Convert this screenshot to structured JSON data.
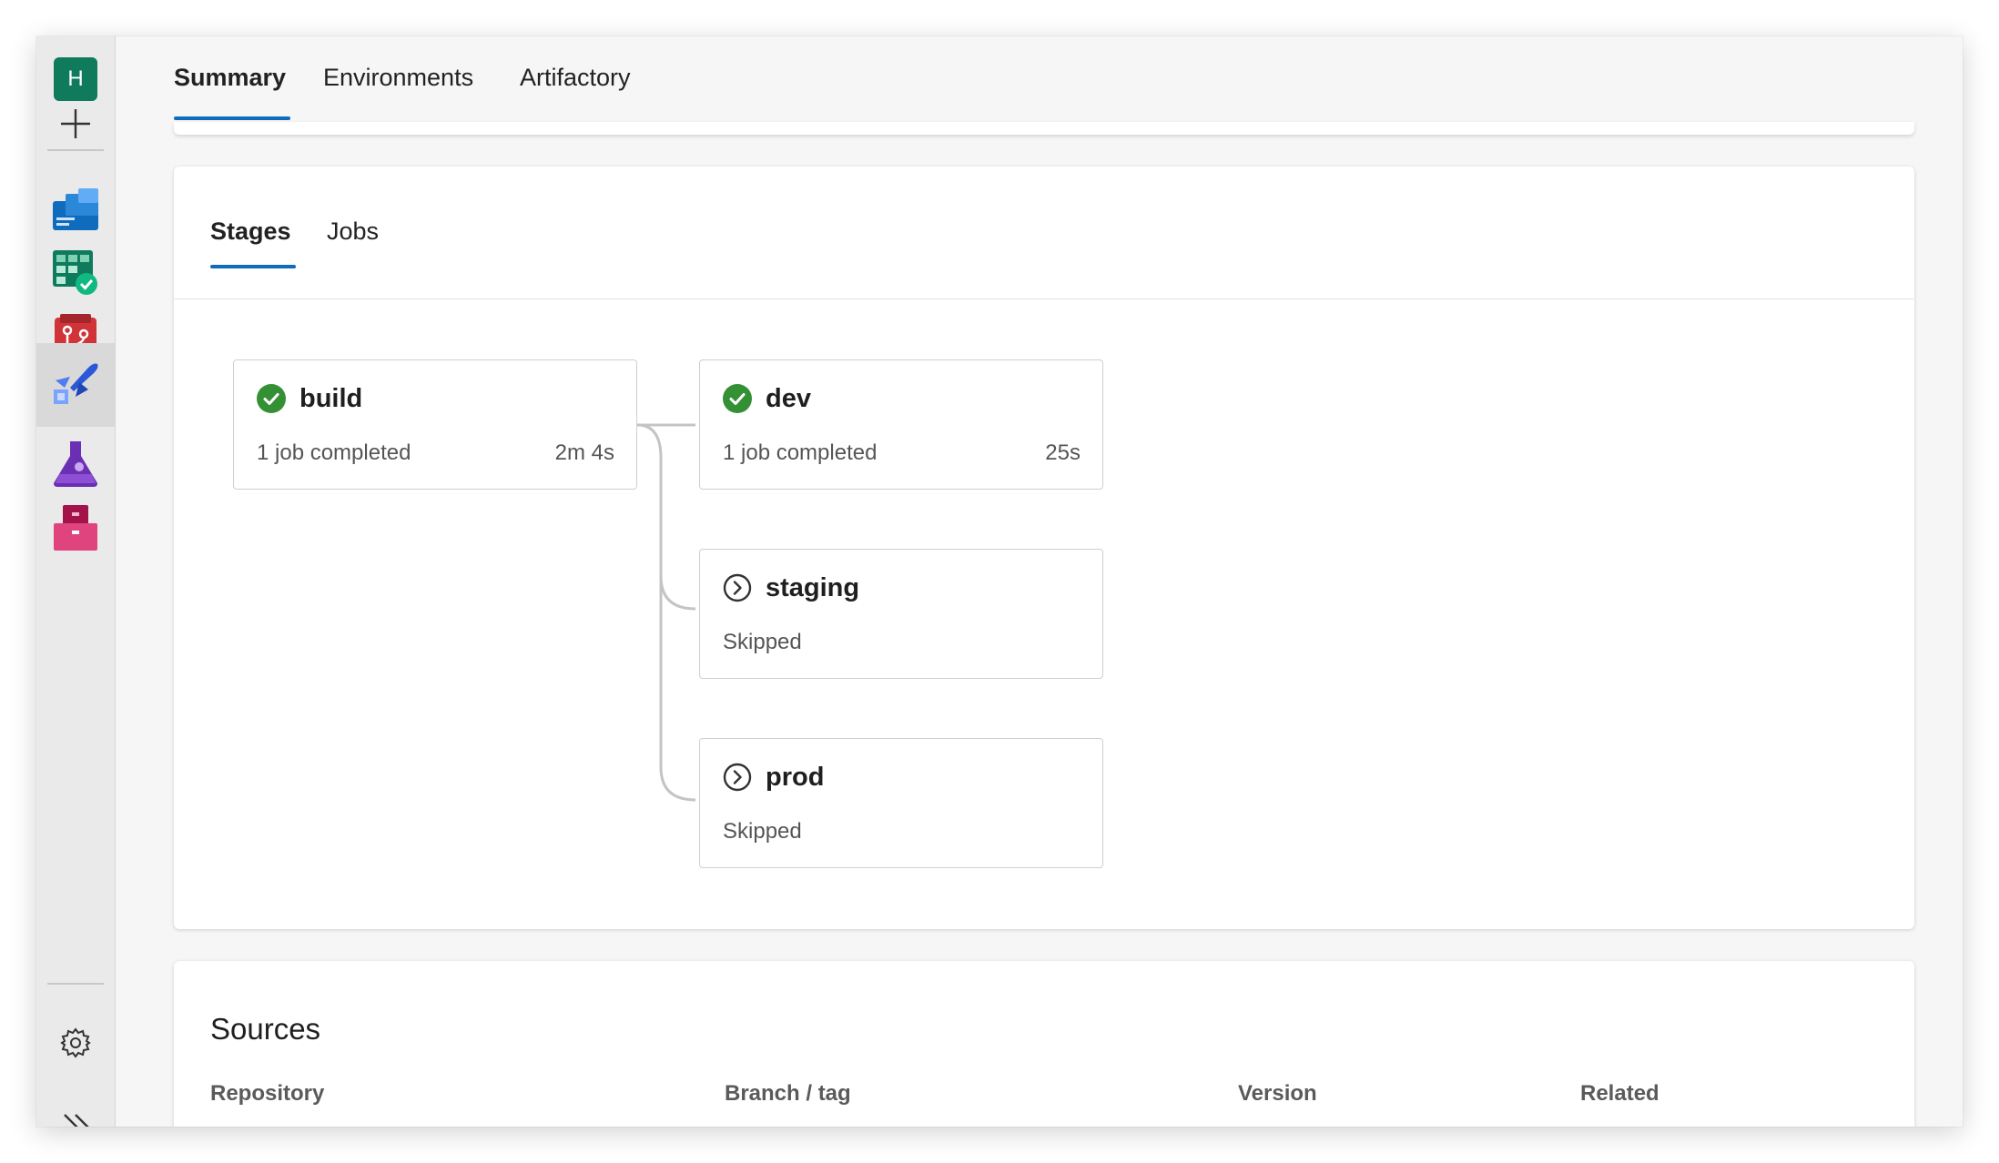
{
  "sidebar": {
    "avatar_letter": "H",
    "items": [
      {
        "name": "new",
        "icon": "plus-icon"
      },
      {
        "name": "overview",
        "icon": "overview-icon",
        "color": "#0f6cbd"
      },
      {
        "name": "boards",
        "icon": "boards-icon",
        "color": "#0f7b5c"
      },
      {
        "name": "repos",
        "icon": "repos-icon",
        "color": "#d13438"
      },
      {
        "name": "pipelines",
        "icon": "pipelines-icon",
        "color": "#2b58d6",
        "active": true
      },
      {
        "name": "test-plans",
        "icon": "test-plans-icon",
        "color": "#6b2fb3"
      },
      {
        "name": "artifacts",
        "icon": "artifacts-icon",
        "color": "#c4205a"
      },
      {
        "name": "settings",
        "icon": "gear-icon"
      },
      {
        "name": "expand",
        "icon": "double-chevron-right-icon"
      }
    ]
  },
  "top_tabs": [
    {
      "label": "Summary",
      "active": true
    },
    {
      "label": "Environments",
      "active": false
    },
    {
      "label": "Artifactory",
      "active": false
    }
  ],
  "sub_tabs": [
    {
      "label": "Stages",
      "active": true
    },
    {
      "label": "Jobs",
      "active": false
    }
  ],
  "stages": [
    {
      "name": "build",
      "status": "1 job completed",
      "duration": "2m 4s",
      "state": "succeeded",
      "icon": "check-circle-icon"
    },
    {
      "name": "dev",
      "status": "1 job completed",
      "duration": "25s",
      "state": "succeeded",
      "icon": "check-circle-icon"
    },
    {
      "name": "staging",
      "status": "Skipped",
      "duration": "",
      "state": "skipped",
      "icon": "skip-circle-icon"
    },
    {
      "name": "prod",
      "status": "Skipped",
      "duration": "",
      "state": "skipped",
      "icon": "skip-circle-icon"
    }
  ],
  "sources": {
    "title": "Sources",
    "columns": [
      "Repository",
      "Branch / tag",
      "Version",
      "Related"
    ]
  },
  "colors": {
    "accent": "#0f6cbd",
    "success": "#107c10"
  }
}
